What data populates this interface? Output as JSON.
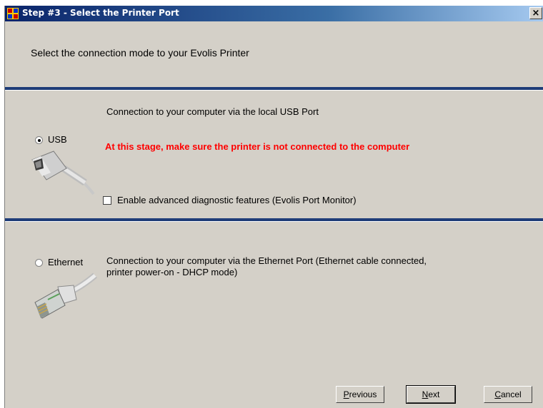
{
  "window": {
    "title": "Step #3 - Select the Printer Port",
    "close_label": "×"
  },
  "heading": "Select the connection mode to your Evolis Printer",
  "usb": {
    "label": "USB",
    "selected": true,
    "description": "Connection to your computer via the local USB Port",
    "warning": "At this stage, make sure the printer is not connected to the computer",
    "advanced_checkbox_label": "Enable advanced diagnostic features (Evolis Port Monitor)",
    "advanced_checked": false,
    "icon": "usb-cable-icon"
  },
  "ethernet": {
    "label": "Ethernet",
    "selected": false,
    "description_line1": "Connection to your computer via the Ethernet Port (Ethernet cable connected,",
    "description_line2": "printer power-on  - DHCP mode)",
    "icon": "ethernet-cable-icon"
  },
  "buttons": {
    "previous_first": "P",
    "previous_rest": "revious",
    "next_first": "N",
    "next_rest": "ext",
    "cancel_first": "C",
    "cancel_rest": "ancel"
  }
}
